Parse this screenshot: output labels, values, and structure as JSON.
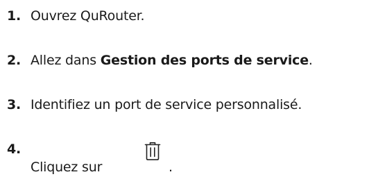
{
  "steps": [
    {
      "number": "1.",
      "text": "Ouvrez QuRouter."
    },
    {
      "number": "2.",
      "prefix": "Allez dans ",
      "bold": "Gestion des ports de service",
      "suffix": "."
    },
    {
      "number": "3.",
      "text": "Identifiez un port de service personnalisé."
    },
    {
      "number": "4.",
      "text": "Cliquez sur",
      "icon": "trash-icon",
      "suffix": "."
    }
  ]
}
